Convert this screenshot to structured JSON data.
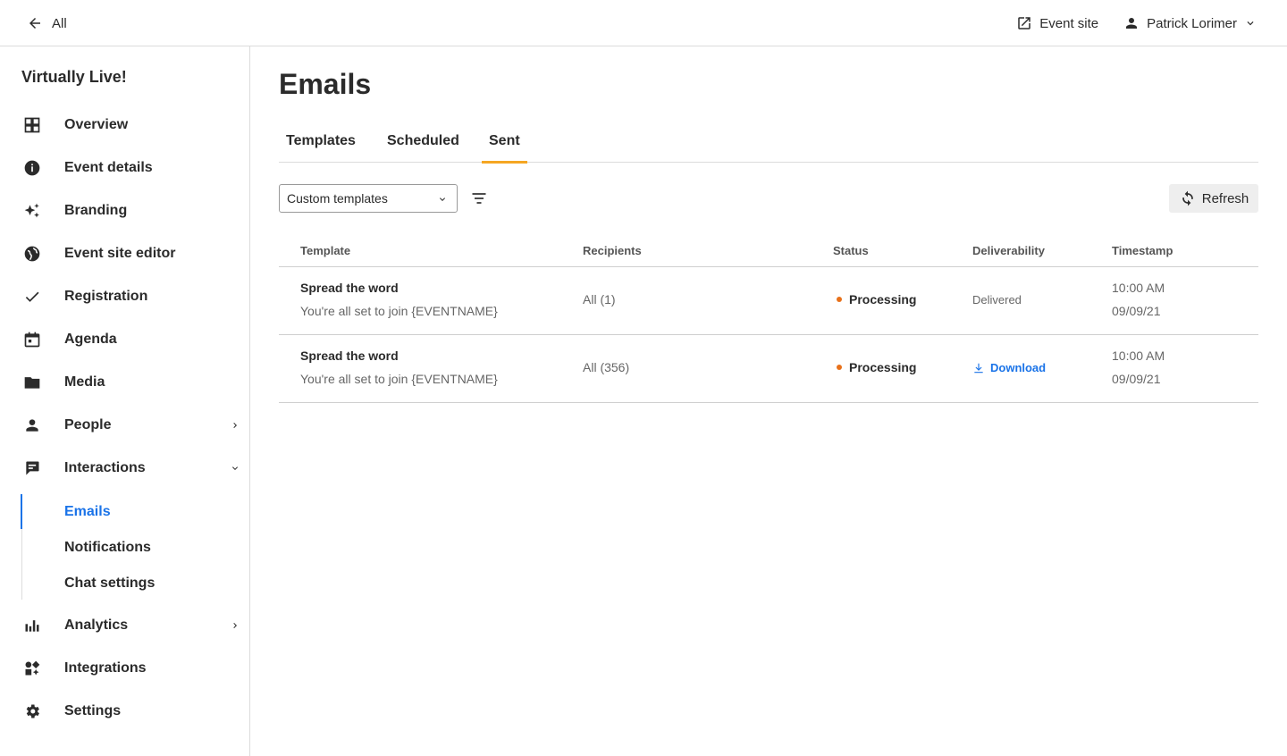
{
  "topbar": {
    "back_label": "All",
    "event_site_label": "Event site",
    "user_name": "Patrick Lorimer"
  },
  "sidebar": {
    "brand": "Virtually Live!",
    "items": [
      {
        "label": "Overview",
        "icon": "grid-icon"
      },
      {
        "label": "Event details",
        "icon": "info-icon"
      },
      {
        "label": "Branding",
        "icon": "sparkles-icon"
      },
      {
        "label": "Event site editor",
        "icon": "globe-icon"
      },
      {
        "label": "Registration",
        "icon": "check-icon"
      },
      {
        "label": "Agenda",
        "icon": "calendar-icon"
      },
      {
        "label": "Media",
        "icon": "folder-icon"
      },
      {
        "label": "People",
        "icon": "person-icon"
      },
      {
        "label": "Interactions",
        "icon": "chat-icon"
      },
      {
        "label": "Analytics",
        "icon": "bar-chart-icon"
      },
      {
        "label": "Integrations",
        "icon": "widgets-icon"
      },
      {
        "label": "Settings",
        "icon": "gear-icon"
      }
    ],
    "sub_items": [
      {
        "label": "Emails",
        "active": true
      },
      {
        "label": "Notifications"
      },
      {
        "label": "Chat settings"
      }
    ]
  },
  "main": {
    "title": "Emails",
    "tabs": [
      "Templates",
      "Scheduled",
      "Sent"
    ],
    "active_tab": "Sent",
    "filter_select": "Custom templates",
    "refresh_label": "Refresh",
    "table": {
      "headers": [
        "Template",
        "Recipients",
        "Status",
        "Deliverability",
        "Timestamp"
      ],
      "rows": [
        {
          "name": "Spread the word",
          "subject": "You're all set to join {EVENTNAME}",
          "recipients": "All (1)",
          "status": "Processing",
          "deliverability": "Delivered",
          "time": "10:00 AM",
          "date": "09/09/21"
        },
        {
          "name": "Spread the word",
          "subject": "You're all set to join {EVENTNAME}",
          "recipients": "All (356)",
          "status": "Processing",
          "deliverability": "Download",
          "time": "10:00 AM",
          "date": "09/09/21"
        }
      ]
    }
  },
  "colors": {
    "accent": "#1a73e8",
    "tab_indicator": "#f5a623",
    "status_dot": "#e8711a"
  }
}
